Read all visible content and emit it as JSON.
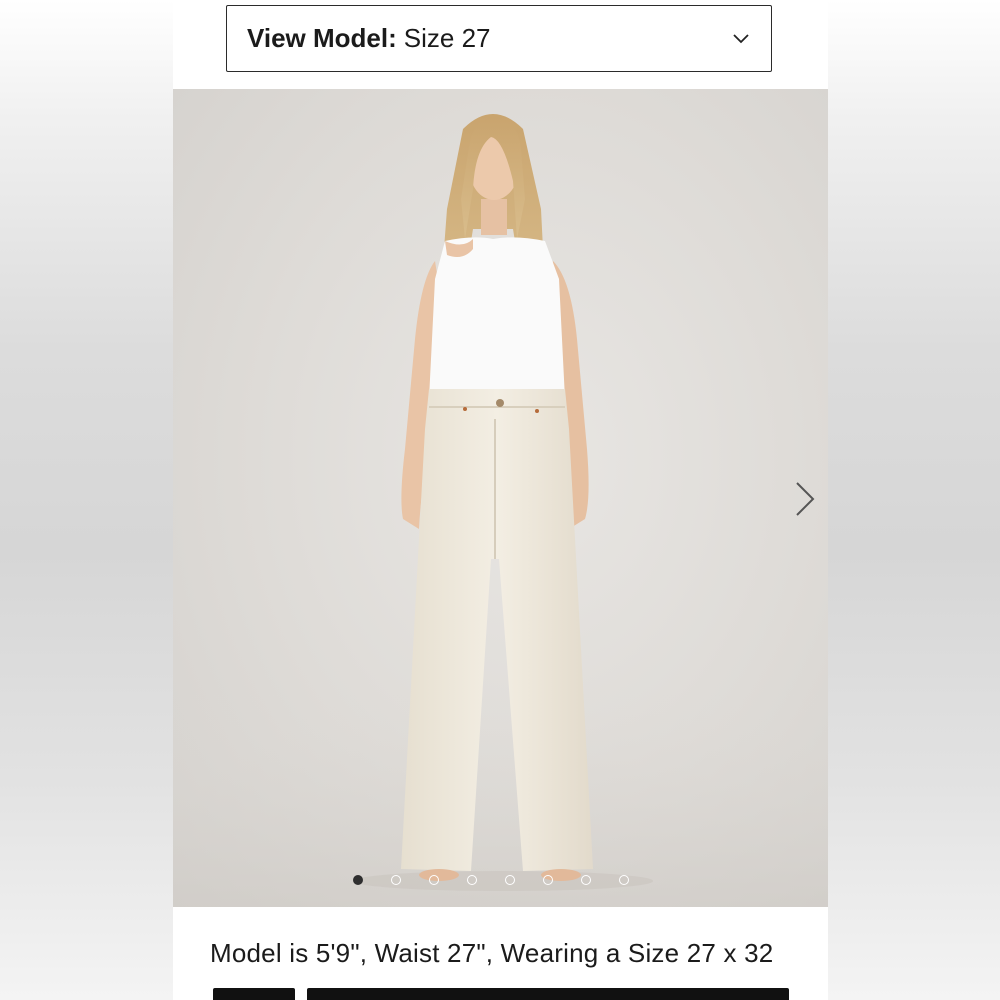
{
  "size_selector": {
    "label": "View Model:",
    "value": "Size 27"
  },
  "gallery": {
    "image_alt": "Model wearing white tank top and ecru wide-leg high-rise jeans",
    "dot_count": 8,
    "active_index": 0
  },
  "model_info": "Model is 5'9\", Waist 27\", Wearing a Size 27 x 32",
  "colors": {
    "pants": "#efe9dc",
    "top": "#fafafa",
    "backdrop": "#dedbd7"
  }
}
